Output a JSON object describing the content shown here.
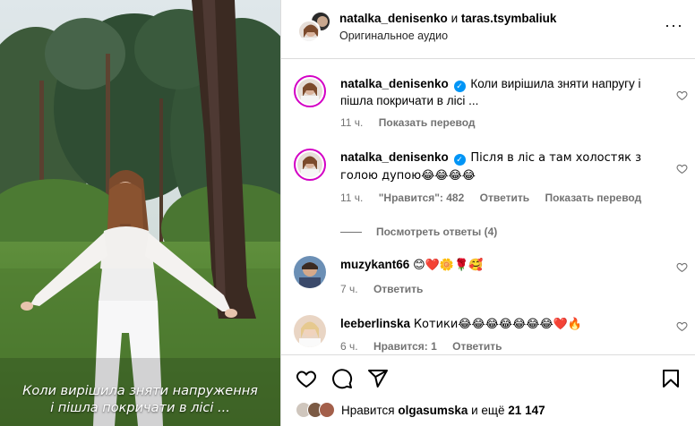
{
  "media": {
    "caption_line1": "Коли вирішила зняти напруження",
    "caption_line2": "і пішла покричати в лісі ..."
  },
  "header": {
    "user1": "natalka_denisenko",
    "conjunction": " и ",
    "user2": "taras.tsymbaliuk",
    "audio": "Оригинальное аудио",
    "more": "···"
  },
  "comments": [
    {
      "user": "natalka_denisenko",
      "verified": true,
      "text": "Коли вирішила зняти напругу і пішла покричати в лісі ...",
      "time": "11 ч.",
      "translate": "Показать перевод"
    },
    {
      "user": "natalka_denisenko",
      "verified": true,
      "text": "Після в ліс а там холостяк з голою дупою😂😂😂😂",
      "time": "11 ч.",
      "likes": "\"Нравится\": 482",
      "reply": "Ответить",
      "translate": "Показать перевод"
    },
    {
      "user": "muzykant66",
      "text": "😊❤️🌼🌹🥰",
      "time": "7 ч.",
      "reply": "Ответить"
    },
    {
      "user": "leeberlinska",
      "text": "Котики😂😂😂😂😂😂😂❤️🔥",
      "time": "6 ч.",
      "likes": "Нравится: 1",
      "reply": "Ответить"
    }
  ],
  "view_replies": "Посмотреть ответы (4)",
  "footer": {
    "liked_by_prefix": "Нравится ",
    "liked_by_user": "olgasumska",
    "liked_by_suffix": " и ещё ",
    "liked_count": "21 147"
  },
  "colors": {
    "link_gray": "#737373",
    "verified_blue": "#0095f6",
    "story_ring": "#d300c5",
    "heart_red": "#ed1c24"
  }
}
